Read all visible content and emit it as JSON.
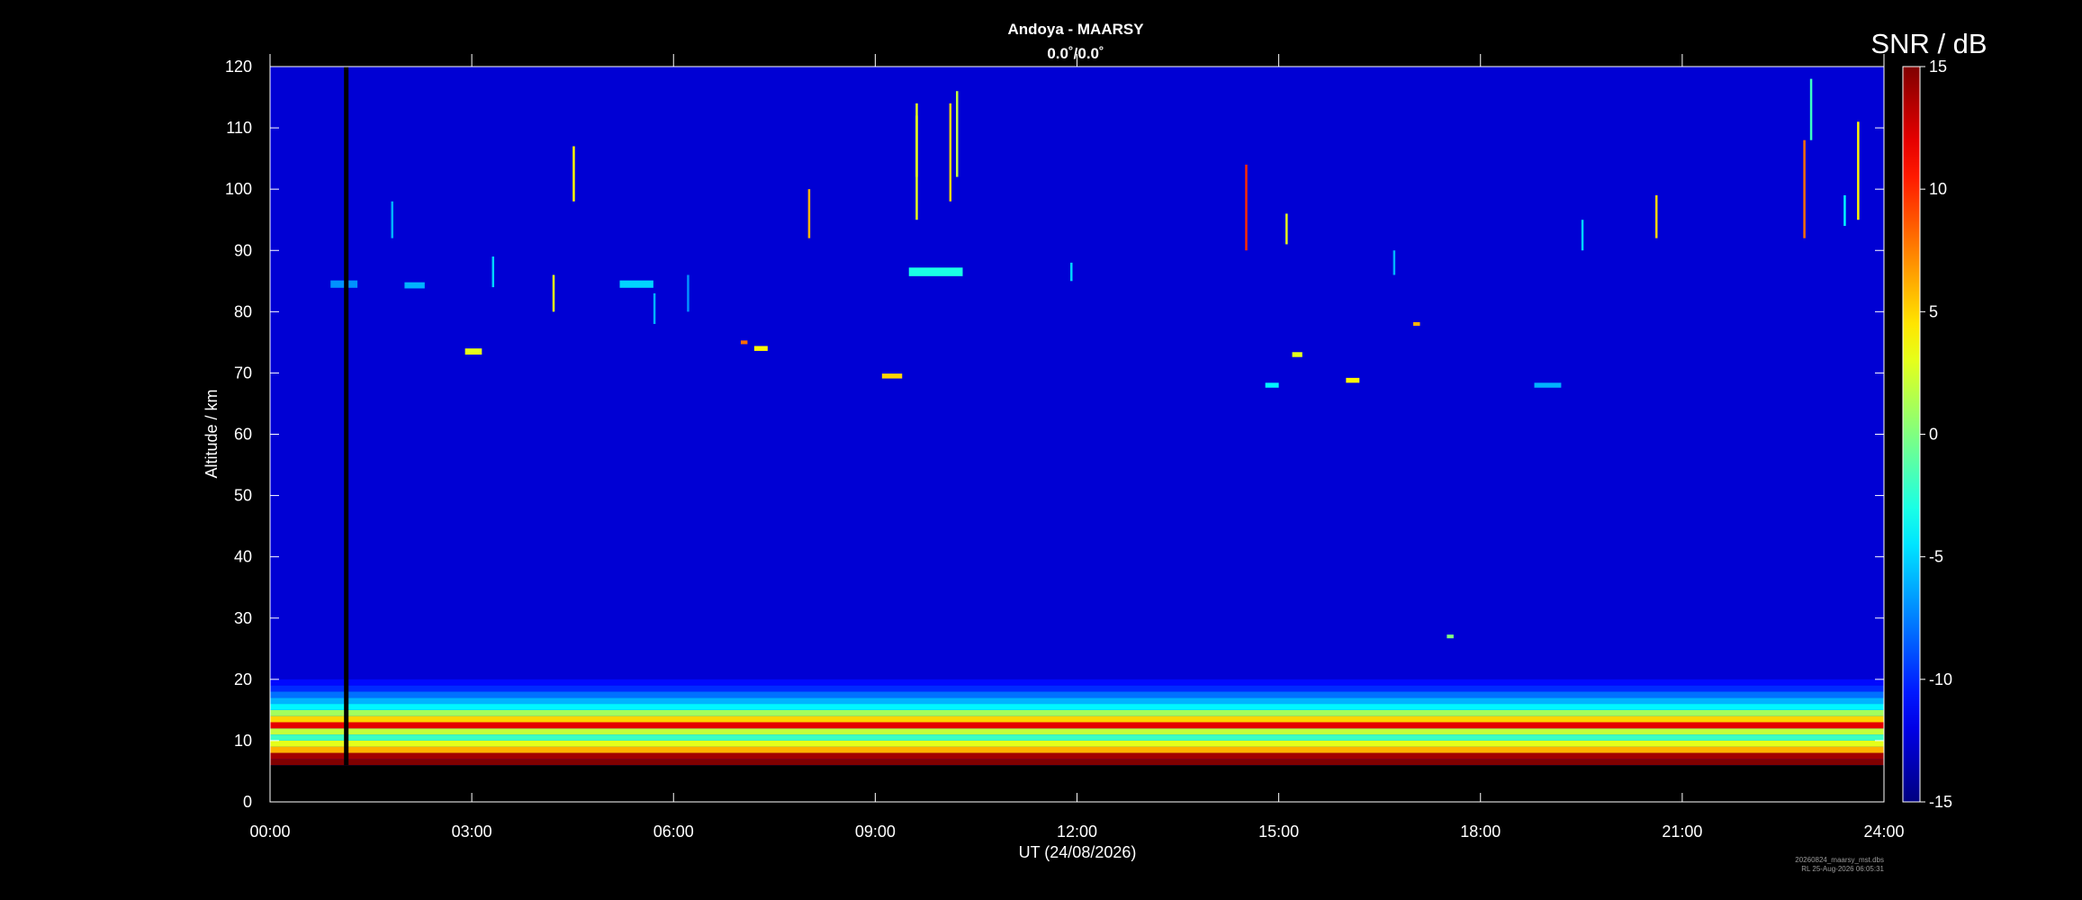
{
  "chart_data": {
    "type": "heatmap",
    "title": "Andoya - MAARSY",
    "subtitle": "0.0˚/0.0˚",
    "xlabel": "UT (24/08/2026)",
    "ylabel": "Altitude / km",
    "colorbar_label": "SNR / dB",
    "xlim_hours": [
      0,
      24
    ],
    "ylim": [
      0,
      120
    ],
    "clim": [
      -15,
      15
    ],
    "x_ticks": [
      "00:00",
      "03:00",
      "06:00",
      "09:00",
      "12:00",
      "15:00",
      "18:00",
      "21:00",
      "24:00"
    ],
    "y_ticks": [
      "0",
      "10",
      "20",
      "30",
      "40",
      "50",
      "60",
      "70",
      "80",
      "90",
      "100",
      "110",
      "120"
    ],
    "colorbar_ticks": [
      "15",
      "10",
      "5",
      "0",
      "-5",
      "-10",
      "-15"
    ],
    "colormap": "jet",
    "background_snr": -12.5,
    "data_gap": {
      "start_hour": 1.1,
      "end_hour": 1.15
    },
    "no_data_below_km": 6,
    "tropospheric_layer": {
      "altitude_km": [
        6,
        20
      ],
      "rows": [
        {
          "altitude_km": 6.5,
          "snr": 15
        },
        {
          "altitude_km": 7.5,
          "snr": 14
        },
        {
          "altitude_km": 8.5,
          "snr": 6
        },
        {
          "altitude_km": 9.5,
          "snr": 3
        },
        {
          "altitude_km": 10.5,
          "snr": -2
        },
        {
          "altitude_km": 11.5,
          "snr": 2
        },
        {
          "altitude_km": 12.5,
          "snr": 12
        },
        {
          "altitude_km": 13.5,
          "snr": 5
        },
        {
          "altitude_km": 14.5,
          "snr": 1
        },
        {
          "altitude_km": 15.5,
          "snr": -4
        },
        {
          "altitude_km": 16.5,
          "snr": -6
        },
        {
          "altitude_km": 17.5,
          "snr": -8
        },
        {
          "altitude_km": 18.5,
          "snr": -10
        },
        {
          "altitude_km": 19.5,
          "snr": -11
        }
      ]
    },
    "echo_patches": [
      {
        "hour": 0.9,
        "altitude_km": 84.5,
        "duration_h": 0.4,
        "thickness_km": 1.2,
        "snr": -7
      },
      {
        "hour": 2.0,
        "altitude_km": 84.3,
        "duration_h": 0.3,
        "thickness_km": 1.0,
        "snr": -6
      },
      {
        "hour": 2.9,
        "altitude_km": 73.5,
        "duration_h": 0.25,
        "thickness_km": 1.0,
        "snr": 3
      },
      {
        "hour": 5.2,
        "altitude_km": 84.5,
        "duration_h": 0.5,
        "thickness_km": 1.2,
        "snr": -5
      },
      {
        "hour": 7.2,
        "altitude_km": 74.0,
        "duration_h": 0.2,
        "thickness_km": 0.8,
        "snr": 4
      },
      {
        "hour": 9.1,
        "altitude_km": 69.5,
        "duration_h": 0.3,
        "thickness_km": 0.8,
        "snr": 5
      },
      {
        "hour": 9.5,
        "altitude_km": 86.5,
        "duration_h": 0.8,
        "thickness_km": 1.4,
        "snr": -3
      },
      {
        "hour": 15.2,
        "altitude_km": 73.0,
        "duration_h": 0.15,
        "thickness_km": 0.8,
        "snr": 3
      },
      {
        "hour": 16.0,
        "altitude_km": 68.8,
        "duration_h": 0.2,
        "thickness_km": 0.8,
        "snr": 4
      },
      {
        "hour": 14.8,
        "altitude_km": 68.0,
        "duration_h": 0.2,
        "thickness_km": 0.8,
        "snr": -4
      },
      {
        "hour": 17.5,
        "altitude_km": 27.0,
        "duration_h": 0.1,
        "thickness_km": 0.6,
        "snr": 0
      },
      {
        "hour": 18.8,
        "altitude_km": 68.0,
        "duration_h": 0.4,
        "thickness_km": 0.8,
        "snr": -6
      },
      {
        "hour": 7.0,
        "altitude_km": 75.0,
        "duration_h": 0.1,
        "thickness_km": 0.6,
        "snr": 8
      },
      {
        "hour": 17.0,
        "altitude_km": 78.0,
        "duration_h": 0.1,
        "thickness_km": 0.6,
        "snr": 6
      }
    ],
    "meteor_streaks": [
      {
        "hour": 4.5,
        "altitude_km": [
          98,
          107
        ],
        "snr": 4
      },
      {
        "hour": 8.0,
        "altitude_km": [
          92,
          100
        ],
        "snr": 6
      },
      {
        "hour": 9.6,
        "altitude_km": [
          102,
          112
        ],
        "snr": 2
      },
      {
        "hour": 9.6,
        "altitude_km": [
          95,
          114
        ],
        "snr": 3
      },
      {
        "hour": 10.1,
        "altitude_km": [
          98,
          114
        ],
        "snr": 5
      },
      {
        "hour": 10.2,
        "altitude_km": [
          102,
          116
        ],
        "snr": 2
      },
      {
        "hour": 14.5,
        "altitude_km": [
          90,
          104
        ],
        "snr": 10
      },
      {
        "hour": 15.1,
        "altitude_km": [
          91,
          96
        ],
        "snr": 3
      },
      {
        "hour": 4.2,
        "altitude_km": [
          80,
          86
        ],
        "snr": 3
      },
      {
        "hour": 20.6,
        "altitude_km": [
          92,
          99
        ],
        "snr": 5
      },
      {
        "hour": 22.8,
        "altitude_km": [
          92,
          108
        ],
        "snr": 8
      },
      {
        "hour": 22.9,
        "altitude_km": [
          108,
          118
        ],
        "snr": -2
      },
      {
        "hour": 23.6,
        "altitude_km": [
          95,
          111
        ],
        "snr": 4
      },
      {
        "hour": 23.4,
        "altitude_km": [
          94,
          99
        ],
        "snr": -4
      },
      {
        "hour": 1.8,
        "altitude_km": [
          92,
          98
        ],
        "snr": -6
      },
      {
        "hour": 3.3,
        "altitude_km": [
          84,
          89
        ],
        "snr": -5
      },
      {
        "hour": 5.7,
        "altitude_km": [
          78,
          83
        ],
        "snr": -6
      },
      {
        "hour": 6.2,
        "altitude_km": [
          80,
          86
        ],
        "snr": -7
      },
      {
        "hour": 11.9,
        "altitude_km": [
          85,
          88
        ],
        "snr": -5
      },
      {
        "hour": 16.7,
        "altitude_km": [
          86,
          90
        ],
        "snr": -6
      },
      {
        "hour": 19.5,
        "altitude_km": [
          90,
          95
        ],
        "snr": -5
      }
    ]
  },
  "footer": {
    "filename": "20260824_maarsy_mst.dbs",
    "timestamp": "RL 25-Aug-2026 06:05:31"
  }
}
